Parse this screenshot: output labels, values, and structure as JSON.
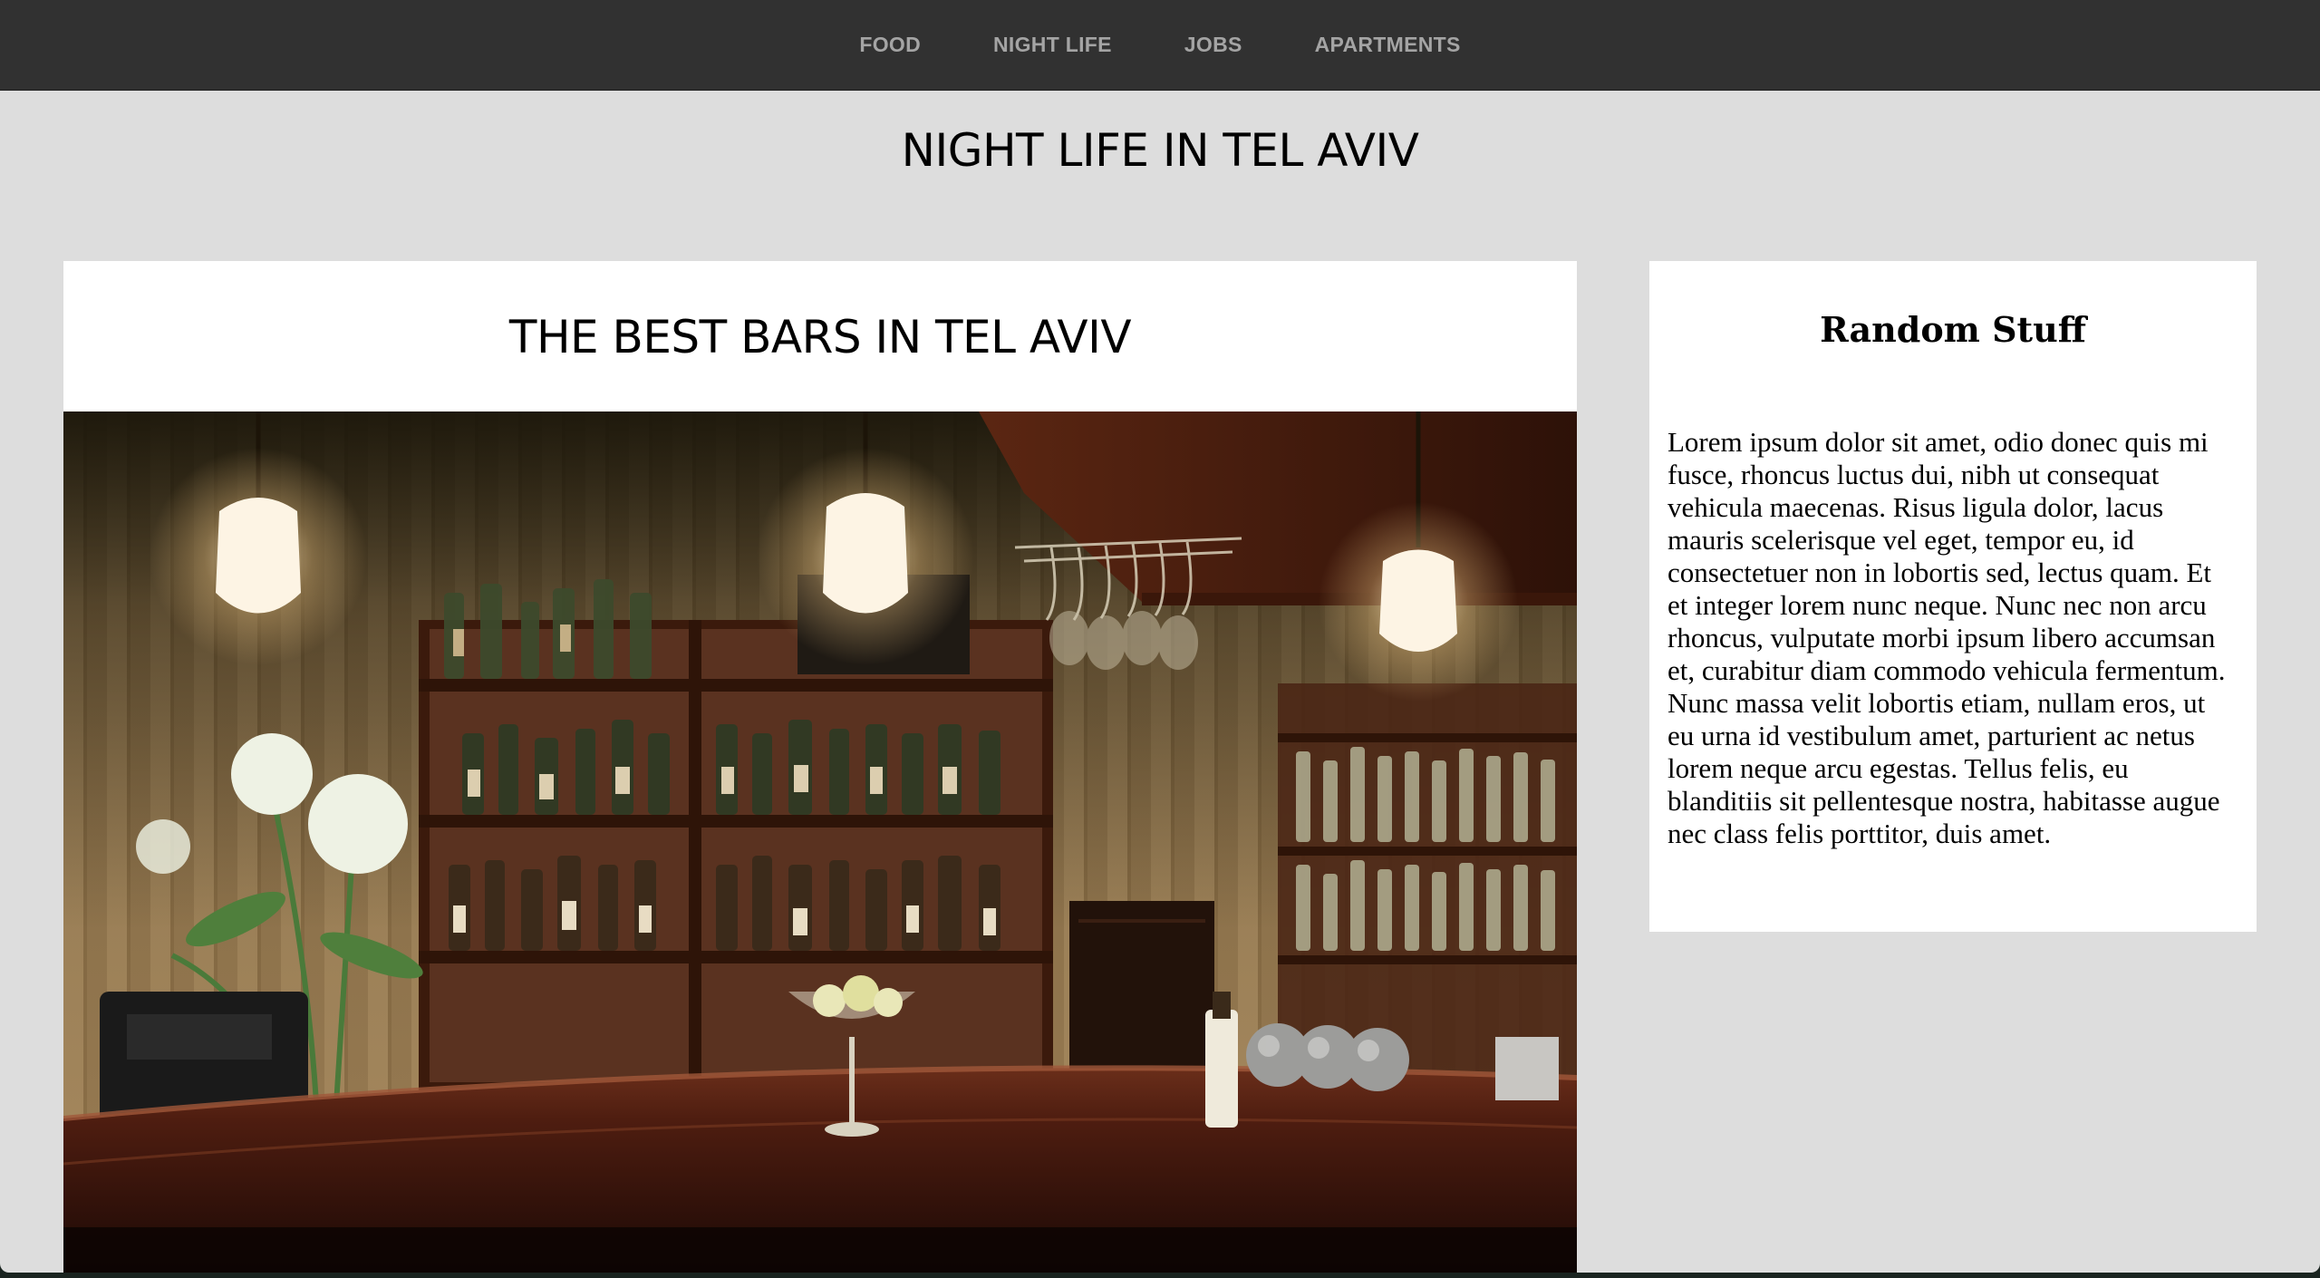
{
  "nav": {
    "items": [
      {
        "label": "FOOD"
      },
      {
        "label": "NIGHT LIFE"
      },
      {
        "label": "JOBS"
      },
      {
        "label": "APARTMENTS"
      }
    ]
  },
  "page": {
    "title": "NIGHT LIFE IN TEL AVIV"
  },
  "article": {
    "title": "THE BEST BARS IN TEL AVIV",
    "image": "bar-interior-photo"
  },
  "sidebar": {
    "title": "Random Stuff",
    "text": "Lorem ipsum dolor sit amet, odio donec quis mi fusce, rhoncus luctus dui, nibh ut consequat vehicula maecenas. Risus ligula dolor, lacus mauris scelerisque vel eget, tempor eu, id consectetuer non in lobortis sed, lectus quam. Et et integer lorem nunc neque. Nunc nec non arcu rhoncus, vulputate morbi ipsum libero accumsan et, curabitur diam commodo vehicula fermentum. Nunc massa velit lobortis etiam, nullam eros, ut eu urna id vestibulum amet, parturient ac netus lorem neque arcu egestas. Tellus felis, eu blanditiis sit pellentesque nostra, habitasse augue nec class felis porttitor, duis amet."
  },
  "colors": {
    "navbar": "#313131",
    "nav_link": "#a4a4a4",
    "page_background": "#dddddd",
    "card_background": "#ffffff"
  }
}
